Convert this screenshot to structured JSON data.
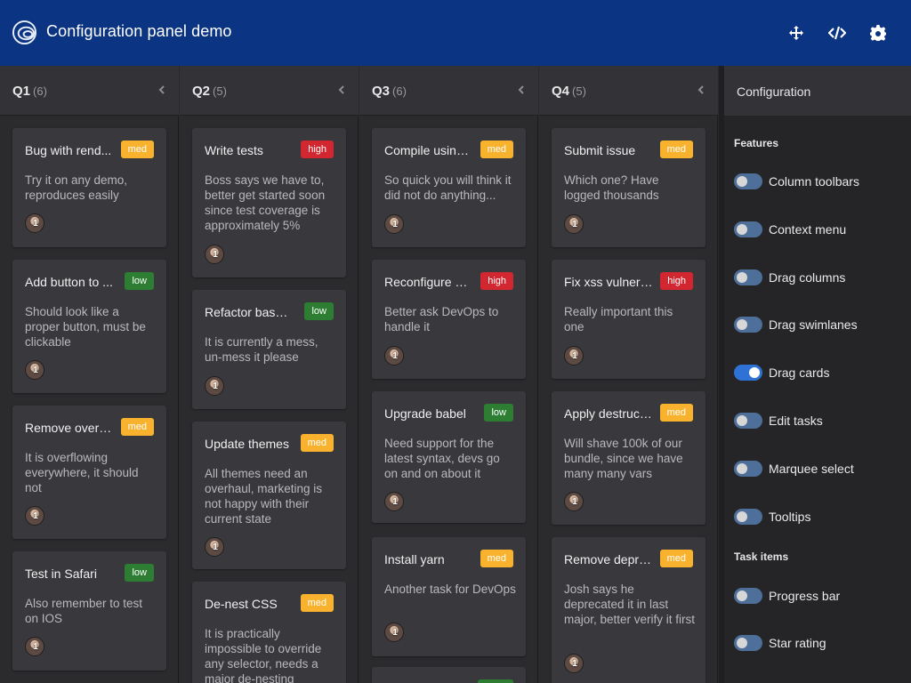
{
  "header": {
    "title": "Configuration panel demo",
    "icons": [
      "logo-icon",
      "move-icon",
      "code-icon",
      "settings-gear-icon"
    ]
  },
  "colors": {
    "header_bg": "#0b3482",
    "med": "#f9b22e",
    "high": "#d22630",
    "low": "#2d7d32",
    "toggle_on": "#2f72d6"
  },
  "columns": [
    {
      "title": "Q1",
      "count": "(6)",
      "cards": [
        {
          "name": "Bug with rend...",
          "prio": "med",
          "desc": "Try it on any demo, reproduces easily",
          "avatar": "1"
        },
        {
          "name": "Add button to ...",
          "prio": "low",
          "desc": "Should look like a proper button, must be clickable",
          "avatar": "1"
        },
        {
          "name": "Remove overfl...",
          "prio": "med",
          "desc": "It is overflowing everywhere, it should not",
          "avatar": "1"
        },
        {
          "name": "Test in Safari",
          "prio": "low",
          "desc": "Also remember to test on IOS",
          "avatar": "1"
        }
      ]
    },
    {
      "title": "Q2",
      "count": "(5)",
      "cards": [
        {
          "name": "Write tests",
          "prio": "high",
          "desc": "Boss says we have to, better get started soon since test coverage is approximately 5%",
          "avatar": "1"
        },
        {
          "name": "Refactor base ...",
          "prio": "low",
          "desc": "It is currently a mess, un-mess it please",
          "avatar": "1"
        },
        {
          "name": "Update themes",
          "prio": "med",
          "desc": "All themes need an overhaul, marketing is not happy with their current state",
          "avatar": "1"
        },
        {
          "name": "De-nest CSS",
          "prio": "med",
          "desc": "It is practically impossible to override any selector, needs a major de-nesting",
          "avatar": ""
        }
      ]
    },
    {
      "title": "Q3",
      "count": "(6)",
      "cards": [
        {
          "name": "Compile using ...",
          "prio": "med",
          "desc": "So quick you will think it did not do anything...",
          "avatar": "1"
        },
        {
          "name": "Reconfigure gr...",
          "prio": "high",
          "desc": "Better ask DevOps to handle it",
          "avatar": "1"
        },
        {
          "name": "Upgrade babel",
          "prio": "low",
          "desc": "Need support for the latest syntax, devs go on and on about it",
          "avatar": "1"
        },
        {
          "name": "Install yarn",
          "prio": "med",
          "desc": "Another task for DevOps",
          "avatar": "1"
        }
      ]
    },
    {
      "title": "Q4",
      "count": "(5)",
      "cards": [
        {
          "name": "Submit issue",
          "prio": "med",
          "desc": "Which one? Have logged thousands",
          "avatar": "1"
        },
        {
          "name": "Fix xss vulnera...",
          "prio": "high",
          "desc": "Really important this one",
          "avatar": "1"
        },
        {
          "name": "Apply destruct...",
          "prio": "med",
          "desc": "Will shave 100k of our bundle, since we have many many vars",
          "avatar": "1"
        },
        {
          "name": "Remove depre...",
          "prio": "med",
          "desc": "Josh says he deprecated it in last major, better verify it first",
          "avatar": "1"
        }
      ]
    }
  ],
  "config": {
    "title": "Configuration",
    "features_title": "Features",
    "features": [
      {
        "label": "Column toolbars",
        "on": false
      },
      {
        "label": "Context menu",
        "on": false
      },
      {
        "label": "Drag columns",
        "on": false
      },
      {
        "label": "Drag swimlanes",
        "on": false
      },
      {
        "label": "Drag cards",
        "on": true
      },
      {
        "label": "Edit tasks",
        "on": false
      },
      {
        "label": "Marquee select",
        "on": false
      },
      {
        "label": "Tooltips",
        "on": false
      }
    ],
    "task_items_title": "Task items",
    "task_items": [
      {
        "label": "Progress bar",
        "on": false
      },
      {
        "label": "Star rating",
        "on": false
      }
    ]
  }
}
